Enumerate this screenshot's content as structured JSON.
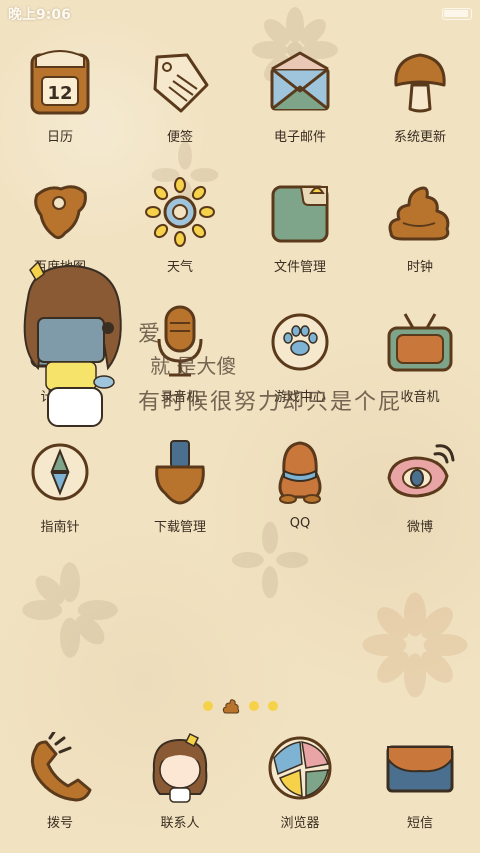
{
  "statusbar": {
    "time": "晚上9:06"
  },
  "overlay": {
    "line1": "爱",
    "line2": "就    是大傻",
    "line3": "有时候很努力却只是个屁"
  },
  "apps": [
    {
      "label": "日历",
      "icon": "calendar-icon",
      "day": "12"
    },
    {
      "label": "便签",
      "icon": "notes-tag-icon"
    },
    {
      "label": "电子邮件",
      "icon": "mail-envelope-icon"
    },
    {
      "label": "系统更新",
      "icon": "mushroom-update-icon"
    },
    {
      "label": "百度地图",
      "icon": "map-blob-icon"
    },
    {
      "label": "天气",
      "icon": "sun-weather-icon"
    },
    {
      "label": "文件管理",
      "icon": "folder-icon"
    },
    {
      "label": "时钟",
      "icon": "poop-clock-icon"
    },
    {
      "label": "计算器",
      "icon": "calculator-icon",
      "symbols": "+-×÷"
    },
    {
      "label": "录音机",
      "icon": "microphone-icon"
    },
    {
      "label": "游戏中心",
      "icon": "paw-game-icon"
    },
    {
      "label": "收音机",
      "icon": "tv-radio-icon"
    },
    {
      "label": "指南针",
      "icon": "compass-icon"
    },
    {
      "label": "下载管理",
      "icon": "download-icon"
    },
    {
      "label": "QQ",
      "icon": "penguin-icon"
    },
    {
      "label": "微博",
      "icon": "eye-weibo-icon"
    }
  ],
  "page_indicator": {
    "count": 4,
    "active": 2
  },
  "dock": [
    {
      "label": "拨号",
      "icon": "phone-handset-icon"
    },
    {
      "label": "联系人",
      "icon": "girl-contacts-icon"
    },
    {
      "label": "浏览器",
      "icon": "globe-browser-icon"
    },
    {
      "label": "短信",
      "icon": "envelope-sms-icon"
    }
  ],
  "colors": {
    "background": "#f1e2c1",
    "brown": "#b8742c",
    "dark_brown": "#5b3a1c",
    "green": "#7ea58a",
    "yellow": "#f6d24a",
    "blue": "#7fb3d4"
  }
}
